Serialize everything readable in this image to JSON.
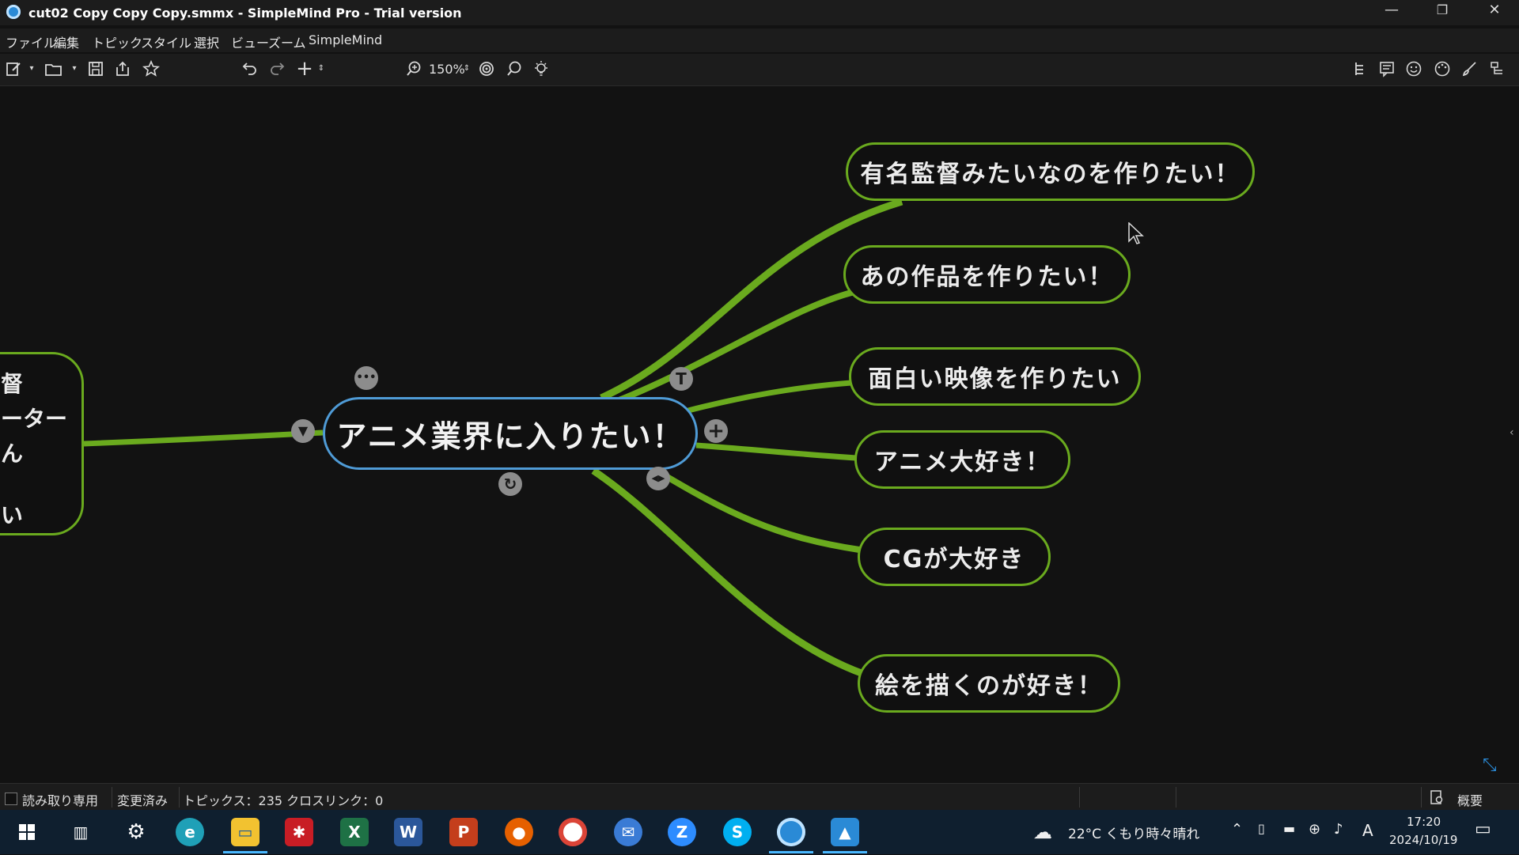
{
  "window": {
    "title": "cut02 Copy Copy Copy.smmx - SimpleMind Pro - Trial version",
    "controls": {
      "minimize": "—",
      "restore": "❐",
      "close": "✕"
    }
  },
  "menu": [
    "ファイル",
    "編集",
    "トピック",
    "スタイル",
    "選択",
    "ビュー",
    "ズーム",
    "SimpleMind"
  ],
  "toolbar": {
    "zoom": "150%",
    "left_icons": [
      "new-document-icon",
      "open-folder-icon",
      "save-icon",
      "share-icon",
      "favorite-star-icon",
      "undo-icon",
      "redo-icon",
      "add-topic-icon"
    ],
    "right_icons": [
      "outline-icon",
      "notes-icon",
      "emoji-icon",
      "style-palette-icon",
      "brush-icon",
      "layout-icon"
    ]
  },
  "mindmap": {
    "central": "アニメ業界に入りたい！",
    "left_node_lines": [
      "督",
      "ーター",
      "ん",
      "",
      "い"
    ],
    "children": [
      "有名監督みたいなのを作りたい！",
      "あの作品を作りたい！",
      "面白い映像を作りたい",
      "アニメ大好き！",
      "CGが大好き",
      "絵を描くのが好き！"
    ],
    "handles": {
      "more": "•••",
      "add": "+",
      "text": "T",
      "rotate": "↻",
      "move": "◀▶",
      "collapse": "▼"
    },
    "branch_color": "#6aaa1e",
    "central_border_color": "#4f9bd6"
  },
  "statusbar": {
    "readonly": "読み取り専用",
    "modified": "変更済み",
    "stats": "トピックス：235 クロスリンク：0",
    "overview": "概要"
  },
  "taskbar": {
    "weather": "22°C くもり時々晴れ",
    "time": "17:20",
    "date": "2024/10/19",
    "ime": "A",
    "apps": [
      "start-icon",
      "task-view-icon",
      "settings-icon",
      "edge-icon",
      "file-explorer-icon",
      "app-red-icon",
      "excel-icon",
      "word-icon",
      "powerpoint-icon",
      "firefox-icon",
      "chrome-icon",
      "mail-icon",
      "zoom-icon",
      "skype-icon",
      "simplemind-icon",
      "photos-icon"
    ]
  }
}
